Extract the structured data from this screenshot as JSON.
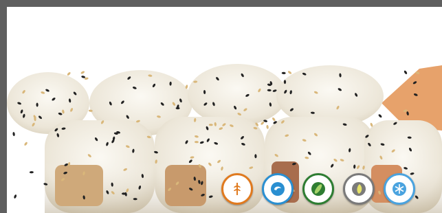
{
  "photo": {
    "subject_icon": "sushi-roll-photo"
  },
  "badges": [
    {
      "icon": "wheat-icon",
      "ring": "#e07a1f",
      "fill": "#ffffff"
    },
    {
      "icon": "shrimp-icon",
      "ring": "#2a8fd1",
      "fill": "#ffffff"
    },
    {
      "icon": "cucumber-icon",
      "ring": "#2e7d32",
      "fill": "#ffffff"
    },
    {
      "icon": "avocado-icon",
      "ring": "#7a7a7a",
      "fill": "#ffffff"
    },
    {
      "icon": "snowflake-icon",
      "ring": "#4aa3df",
      "fill": "#ffffff"
    }
  ],
  "colors": {
    "frame": "#5f5f5f",
    "rice": "#f5f1e8",
    "sesame_dark": "#222222",
    "sesame_light": "#d9b77a",
    "tempura": "#e7a26b"
  }
}
